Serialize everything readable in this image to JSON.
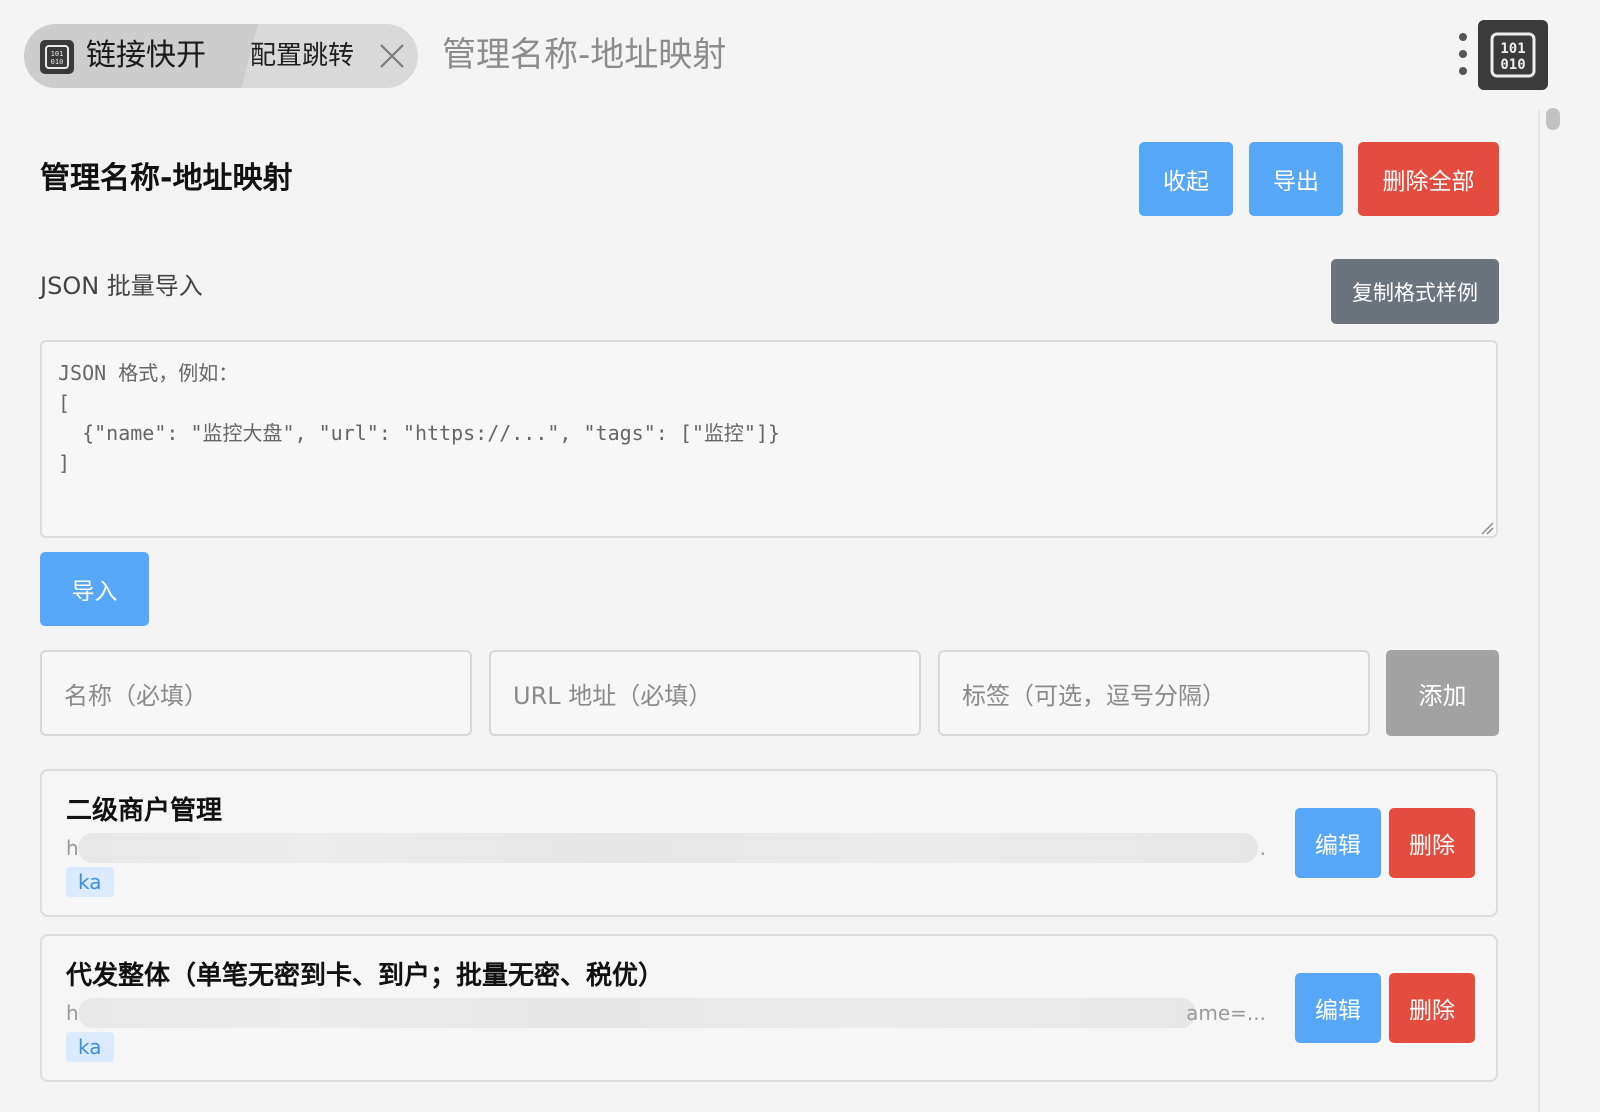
{
  "header": {
    "tabs": [
      {
        "label": "链接快开",
        "active": true,
        "icon": "binary-icon"
      },
      {
        "label": "配置跳转",
        "active": false,
        "closable": true
      }
    ],
    "breadcrumb": "管理名称-地址映射",
    "menu_icon": "more-vertical-icon",
    "corner_icon": "binary-icon"
  },
  "page": {
    "title": "管理名称-地址映射",
    "actions": {
      "collapse": "收起",
      "export": "导出",
      "delete_all": "删除全部"
    }
  },
  "bulk_import": {
    "label": "JSON 批量导入",
    "copy_sample": "复制格式样例",
    "placeholder_lines": [
      "JSON 格式，例如：",
      "[",
      "  {\"name\": \"监控大盘\", \"url\": \"https://...\", \"tags\": [\"监控\"]}",
      "]"
    ],
    "import_button": "导入"
  },
  "add_form": {
    "name_placeholder": "名称（必填）",
    "url_placeholder": "URL 地址（必填）",
    "tags_placeholder": "标签（可选，逗号分隔）",
    "add_button": "添加"
  },
  "entries": [
    {
      "name": "二级商户管理",
      "url_prefix": "h",
      "url_suffix": ".",
      "tag": "ka",
      "edit": "编辑",
      "delete": "删除"
    },
    {
      "name": "代发整体（单笔无密到卡、到户；批量无密、税优）",
      "url_prefix": "h",
      "url_suffix": "ame=...",
      "tag": "ka",
      "edit": "编辑",
      "delete": "删除"
    }
  ],
  "colors": {
    "primary": "#56a7f7",
    "danger": "#e44c3f",
    "neutral": "#6b737c",
    "disabled": "#a2a2a2",
    "tag_bg": "#dbeafc",
    "tag_text": "#3a8ee6"
  }
}
